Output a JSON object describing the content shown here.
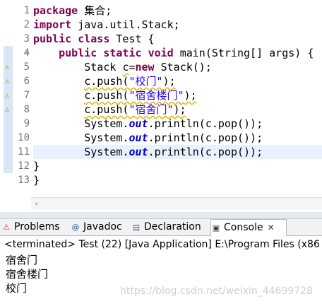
{
  "editor": {
    "lines": [
      {
        "n": "1",
        "segments": [
          {
            "t": "package",
            "c": "kw"
          },
          {
            "t": " 集合;",
            "c": ""
          }
        ]
      },
      {
        "n": "2",
        "segments": [
          {
            "t": "import",
            "c": "kw"
          },
          {
            "t": " java.util.Stack;",
            "c": ""
          }
        ]
      },
      {
        "n": "3",
        "segments": [
          {
            "t": "public",
            "c": "kw"
          },
          {
            "t": " ",
            "c": ""
          },
          {
            "t": "class",
            "c": "kw"
          },
          {
            "t": " Test {",
            "c": ""
          }
        ]
      },
      {
        "n": "4",
        "segments": [
          {
            "t": "    ",
            "c": ""
          },
          {
            "t": "public",
            "c": "kw"
          },
          {
            "t": " ",
            "c": ""
          },
          {
            "t": "static",
            "c": "kw"
          },
          {
            "t": " ",
            "c": ""
          },
          {
            "t": "void",
            "c": "kw"
          },
          {
            "t": " main(String[] args) {",
            "c": ""
          }
        ]
      },
      {
        "n": "5",
        "segments": [
          {
            "t": "        Stack ",
            "c": ""
          },
          {
            "t": "c",
            "c": "squig"
          },
          {
            "t": "=",
            "c": ""
          },
          {
            "t": "new",
            "c": "kw"
          },
          {
            "t": " Stack();",
            "c": ""
          }
        ]
      },
      {
        "n": "6",
        "segments": [
          {
            "t": "        ",
            "c": ""
          },
          {
            "t": "c.push(",
            "c": "squig"
          },
          {
            "t": "\"校门\"",
            "c": "str squig"
          },
          {
            "t": ");",
            "c": "squig"
          }
        ]
      },
      {
        "n": "7",
        "segments": [
          {
            "t": "        ",
            "c": ""
          },
          {
            "t": "c.push(",
            "c": "squig"
          },
          {
            "t": "\"宿舍楼门\"",
            "c": "str squig"
          },
          {
            "t": ");",
            "c": "squig"
          }
        ]
      },
      {
        "n": "8",
        "segments": [
          {
            "t": "        ",
            "c": ""
          },
          {
            "t": "c.push(",
            "c": "squig"
          },
          {
            "t": "\"宿舍门\"",
            "c": "str squig"
          },
          {
            "t": ");",
            "c": "squig"
          }
        ]
      },
      {
        "n": "9",
        "segments": [
          {
            "t": "        System.",
            "c": ""
          },
          {
            "t": "out",
            "c": "field"
          },
          {
            "t": ".println(c.pop());",
            "c": ""
          }
        ]
      },
      {
        "n": "10",
        "segments": [
          {
            "t": "        System.",
            "c": ""
          },
          {
            "t": "out",
            "c": "field"
          },
          {
            "t": ".println(c.pop());",
            "c": ""
          }
        ]
      },
      {
        "n": "11",
        "segments": [
          {
            "t": "        System.",
            "c": ""
          },
          {
            "t": "out",
            "c": "field"
          },
          {
            "t": ".println(c.pop());",
            "c": ""
          }
        ]
      },
      {
        "n": "12",
        "segments": [
          {
            "t": "}",
            "c": ""
          }
        ]
      },
      {
        "n": "13",
        "segments": [
          {
            "t": "}",
            "c": ""
          }
        ]
      }
    ],
    "warning_icon": "warning-icon",
    "fold_icon": "fold-collapse-icon",
    "scroll_left_icon": "scroll-left-arrow-icon"
  },
  "tabs": [
    {
      "label": "Problems",
      "icon": "problems-icon",
      "glyph": "⚠"
    },
    {
      "label": "Javadoc",
      "icon": "javadoc-icon",
      "glyph": "@"
    },
    {
      "label": "Declaration",
      "icon": "declaration-icon",
      "glyph": "▤"
    },
    {
      "label": "Console",
      "icon": "console-icon",
      "glyph": "▣",
      "active": true
    }
  ],
  "console": {
    "status": "<terminated> Test (22) [Java Application] E:\\Program Files (x86",
    "output": [
      "宿舍门",
      "宿舍楼门",
      "校门"
    ],
    "watermark": "https://blog.csdn.net/weixin_44699728"
  },
  "colors": {
    "keyword": "#7f0055",
    "string": "#2a00ff",
    "static_field": "#0000c0",
    "current_line": "#e8f2fe",
    "warning_underline": "#d9b500"
  }
}
